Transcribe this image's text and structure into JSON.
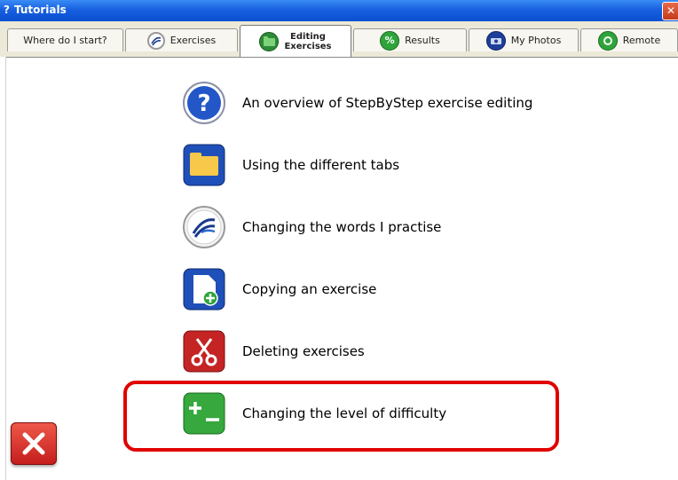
{
  "window": {
    "title": "Tutorials",
    "title_icon": "?"
  },
  "tabs": [
    {
      "label": "Where do I start?",
      "icon": "none"
    },
    {
      "label": "Exercises",
      "icon": "stepbystep-logo"
    },
    {
      "label": "Editing Exercises",
      "label_line1": "Editing",
      "label_line2": "Exercises",
      "icon": "folder",
      "active": true
    },
    {
      "label": "Results",
      "icon": "percent",
      "icon_text": "%"
    },
    {
      "label": "My Photos",
      "icon": "camera"
    },
    {
      "label": "Remote",
      "icon": "remote-help"
    }
  ],
  "items": [
    {
      "label": "An overview of StepByStep exercise editing",
      "icon": "question-icon",
      "icon_text": "?"
    },
    {
      "label": "Using the different tabs",
      "icon": "folder-icon"
    },
    {
      "label": "Changing the words I practise",
      "icon": "stepbystep-logo-icon"
    },
    {
      "label": "Copying an exercise",
      "icon": "copy-icon"
    },
    {
      "label": "Deleting exercises",
      "icon": "scissors-icon"
    },
    {
      "label": "Changing the level of difficulty",
      "icon": "plus-minus-icon",
      "icon_text": "+_"
    }
  ],
  "highlighted_item": "Changing the level of difficulty",
  "colors": {
    "accent_blue": "#1760e0",
    "highlight_red": "#e00000",
    "close_red": "#c41c1c"
  }
}
